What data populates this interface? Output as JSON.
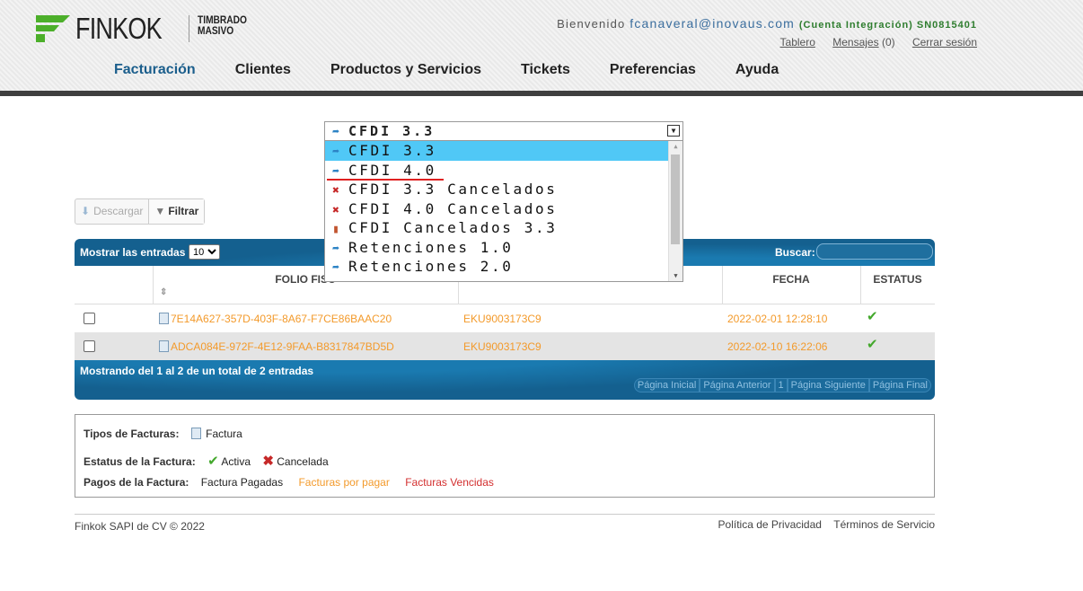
{
  "header": {
    "logo_text": "FINKOK",
    "logo_sub_1": "TIMBRADO",
    "logo_sub_2": "MASIVO",
    "welcome_prefix": "Bienvenido ",
    "email": "fcanaveral@inovaus.com",
    "account_info": "(Cuenta Integración) SN0815401",
    "links": {
      "dashboard": "Tablero",
      "messages": "Mensajes",
      "messages_count": "(0)",
      "logout": "Cerrar sesión"
    },
    "nav": [
      "Facturación",
      "Clientes",
      "Productos y Servicios",
      "Tickets",
      "Preferencias",
      "Ayuda"
    ],
    "active_nav": "Facturación"
  },
  "toolbar": {
    "download_label": "Descargar",
    "filter_label": "Filtrar"
  },
  "dropdown": {
    "selected": "CFDI 3.3",
    "options": [
      {
        "label": "CFDI 3.3",
        "icon": "share-icon",
        "highlighted": true
      },
      {
        "label": "CFDI 4.0",
        "icon": "share-icon",
        "highlighted": false
      },
      {
        "label": "CFDI 3.3 Cancelados",
        "icon": "x-icon",
        "highlighted": false
      },
      {
        "label": "CFDI 4.0 Cancelados",
        "icon": "x-icon",
        "highlighted": false
      },
      {
        "label": "CFDI Cancelados 3.3",
        "icon": "book-icon",
        "highlighted": false
      },
      {
        "label": "Retenciones 1.0",
        "icon": "share-icon",
        "highlighted": false
      },
      {
        "label": "Retenciones 2.0",
        "icon": "share-icon",
        "highlighted": false
      }
    ]
  },
  "grid": {
    "show_entries_label": "Mostrar las entradas",
    "page_size": "10",
    "search_label": "Buscar:",
    "columns": {
      "folio": "FOLIO FISC",
      "fecha": "FECHA",
      "estatus": "ESTATUS"
    },
    "rows": [
      {
        "folio": "7E14A627-357D-403F-8A67-F7CE86BAAC20",
        "rfc": "EKU9003173C9",
        "fecha": "2022-02-01 12:28:10",
        "status": "activa"
      },
      {
        "folio": "ADCA084E-972F-4E12-9FAA-B8317847BD5D",
        "rfc": "EKU9003173C9",
        "fecha": "2022-02-10 16:22:06",
        "status": "activa"
      }
    ],
    "info": "Mostrando del 1 al 2 de un total de 2 entradas",
    "pager": [
      "Página Inicial",
      "Página Anterior",
      "1",
      "Página Siguiente",
      "Página Final"
    ]
  },
  "legend": {
    "types_label": "Tipos de Facturas:",
    "type_factura": "Factura",
    "status_label": "Estatus de la Factura:",
    "status_active": "Activa",
    "status_cancelled": "Cancelada",
    "payments_label": "Pagos de la Factura:",
    "paid": "Factura Pagadas",
    "pending": "Facturas por pagar",
    "overdue": "Facturas Vencidas"
  },
  "footer": {
    "copyright": "Finkok SAPI de CV © 2022",
    "privacy": "Política de Privacidad",
    "terms": "Términos de Servicio"
  },
  "colors": {
    "accent_blue": "#14608f",
    "highlight": "#50c8f6",
    "orange": "#f39a2b",
    "red": "#c62828",
    "green": "#43a82c"
  }
}
